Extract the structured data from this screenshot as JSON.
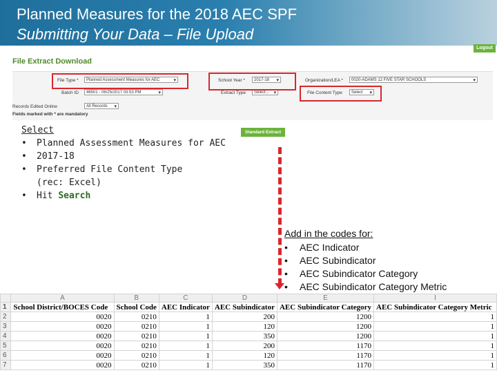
{
  "slide": {
    "title": "Planned Measures for the 2018 AEC SPF",
    "subtitle": "Submitting Your Data – File Upload"
  },
  "app": {
    "logout_label": "Logout",
    "section_title": "File Extract Download",
    "form": {
      "file_type_label": "File Type *",
      "file_type_value": "Planned Assessment Measures for AEC",
      "school_year_label": "School Year *",
      "school_year_value": "2017-18",
      "org_label": "Organization/LEA *",
      "org_value": "0020-ADAMS 12 FIVE STAR SCHOOLS",
      "batch_id_label": "Batch ID",
      "batch_id_value": "46501 - 06/25/2017 03:53 PM",
      "extract_type_label": "Extract Type",
      "extract_type_value": "Select...",
      "file_content_type_label": "File Content Type",
      "file_content_type_value": "Select",
      "records_edited_label": "Records Edited Online",
      "records_edited_value": "All Records",
      "mandatory_note": "Fields marked with * are mandatory"
    },
    "standard_extract_label": "Standard Extract"
  },
  "instructions_left": {
    "heading": "Select",
    "items": [
      "Planned Assessment Measures for AEC",
      "2017-18",
      "Preferred File Content Type (rec: Excel)",
      "Hit "
    ],
    "search_word": "Search"
  },
  "instructions_right": {
    "heading": "Add in the codes for:",
    "items": [
      "AEC Indicator",
      "AEC Subindicator",
      "AEC Subindicator Category",
      "AEC Subindicator Category Metric"
    ]
  },
  "spreadsheet": {
    "col_letters": [
      "A",
      "B",
      "C",
      "D",
      "E",
      "I"
    ],
    "headers": [
      "School District/BOCES Code",
      "School Code",
      "AEC Indicator",
      "AEC Subindicator",
      "AEC Subindicator Category",
      "AEC Subindicator Category Metric"
    ],
    "rows": [
      [
        "0020",
        "0210",
        "1",
        "200",
        "1200",
        "1"
      ],
      [
        "0020",
        "0210",
        "1",
        "120",
        "1200",
        "1"
      ],
      [
        "0020",
        "0210",
        "1",
        "350",
        "1200",
        "1"
      ],
      [
        "0020",
        "0210",
        "1",
        "200",
        "1170",
        "1"
      ],
      [
        "0020",
        "0210",
        "1",
        "120",
        "1170",
        "1"
      ],
      [
        "0020",
        "0210",
        "1",
        "350",
        "1170",
        "1"
      ]
    ]
  },
  "colors": {
    "accent_red": "#d9262c",
    "brand_green": "#6bb33c",
    "header_blue": "#1f6f9c"
  }
}
